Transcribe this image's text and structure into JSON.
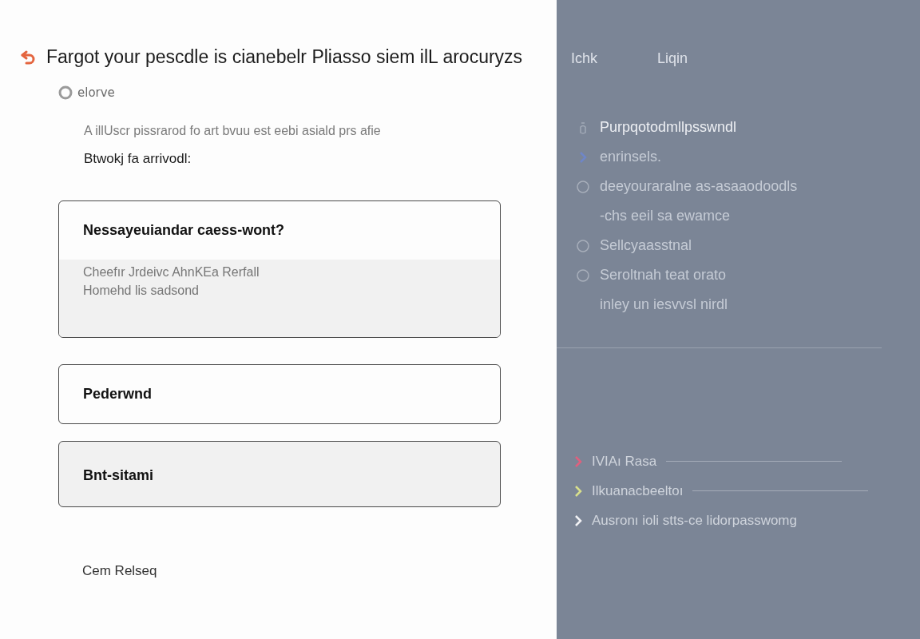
{
  "title": "Fargot your pescdle is cianebelr Pliasso siem ilL arocuryzs",
  "subtitle": "elorve",
  "intro": "A illUscr pissrarod fo art bvuu est eebi asiald prs afie",
  "prompt": "Btwokj fa arrivodl:",
  "options": [
    {
      "heading": "Nessayeuiandar caess-wont?",
      "selected": false,
      "expanded": true,
      "lines": [
        "Cheefır Jrdeivc AhnKEa Rerfall",
        "Homehd lis sadsond"
      ]
    },
    {
      "heading": "Pederwnd",
      "selected": false,
      "expanded": false
    },
    {
      "heading": "Bnt-sitami",
      "selected": true,
      "expanded": false
    }
  ],
  "footer_link": "Cem Relseq",
  "side": {
    "tabs": [
      "Ichk",
      "Liqin"
    ],
    "items": [
      {
        "kind": "mark",
        "text": "Purpqotodmllpsswndl"
      },
      {
        "kind": "chevron",
        "text": "enrinsels."
      },
      {
        "kind": "circle",
        "text": "deeyouraralne as-asaaodoodls"
      },
      {
        "kind": "plain",
        "text": "-chs eeil sa ewamce"
      },
      {
        "kind": "circle",
        "text": "Sellcyaasstnal"
      },
      {
        "kind": "circle",
        "text": "Seroltnah teat orato"
      },
      {
        "kind": "plain",
        "text": "inley un iesvvsl nirdl"
      }
    ],
    "links": [
      {
        "text": "IVIAı Rasa",
        "color": "#e0607e",
        "rule": true
      },
      {
        "text": "Ilkuanacbeeltoı",
        "color": "#d9e08c",
        "rule": true
      },
      {
        "text": "Ausronı ioli stts-ce lidorpasswomg",
        "color": "#f2f2f5",
        "rule": false
      }
    ]
  }
}
